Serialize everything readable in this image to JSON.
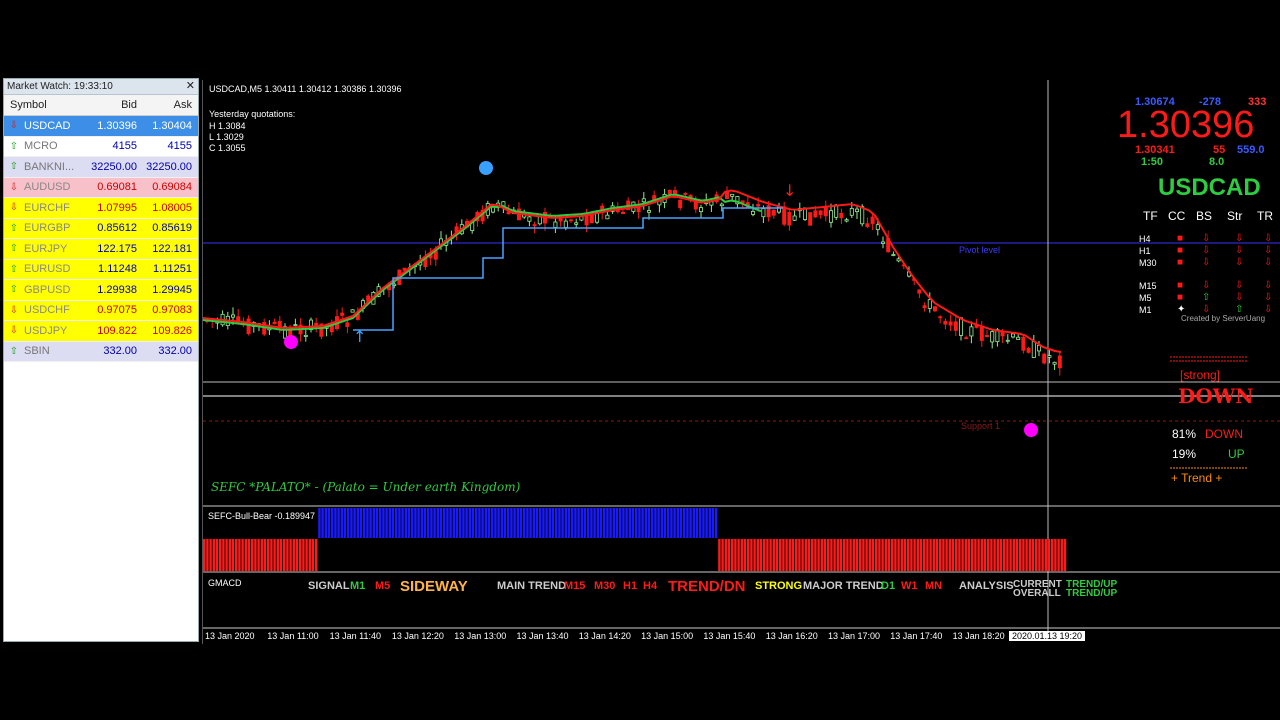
{
  "market_watch": {
    "title": "Market Watch: 19:33:10",
    "close": "✕",
    "columns": {
      "symbol": "Symbol",
      "bid": "Bid",
      "ask": "Ask"
    },
    "rows": [
      {
        "symbol": "USDCAD",
        "bid": "1.30396",
        "ask": "1.30404",
        "dir": "down",
        "bg": "#3d8ee6",
        "fg": "#ffffff"
      },
      {
        "symbol": "MCRO",
        "bid": "4155",
        "ask": "4155",
        "dir": "up",
        "bg": "#ffffff",
        "fg": "#777777"
      },
      {
        "symbol": "BANKNI...",
        "bid": "32250.00",
        "ask": "32250.00",
        "dir": "up",
        "bg": "#dcdcf2",
        "fg": "#777777"
      },
      {
        "symbol": "AUDUSD",
        "bid": "0.69081",
        "ask": "0.69084",
        "dir": "down",
        "bg": "#f8c0c8",
        "fg": "#888888"
      },
      {
        "symbol": "EURCHF",
        "bid": "1.07995",
        "ask": "1.08005",
        "dir": "down",
        "bg": "#ffff00",
        "fg": "#888888"
      },
      {
        "symbol": "EURGBP",
        "bid": "0.85612",
        "ask": "0.85619",
        "dir": "up",
        "bg": "#ffff00",
        "fg": "#888888"
      },
      {
        "symbol": "EURJPY",
        "bid": "122.175",
        "ask": "122.181",
        "dir": "up",
        "bg": "#ffff00",
        "fg": "#888888"
      },
      {
        "symbol": "EURUSD",
        "bid": "1.11248",
        "ask": "1.11251",
        "dir": "up",
        "bg": "#ffff00",
        "fg": "#888888"
      },
      {
        "symbol": "GBPUSD",
        "bid": "1.29938",
        "ask": "1.29945",
        "dir": "up",
        "bg": "#ffff00",
        "fg": "#888888"
      },
      {
        "symbol": "USDCHF",
        "bid": "0.97075",
        "ask": "0.97083",
        "dir": "down",
        "bg": "#ffff00",
        "fg": "#888888"
      },
      {
        "symbol": "USDJPY",
        "bid": "109.822",
        "ask": "109.826",
        "dir": "down",
        "bg": "#ffff00",
        "fg": "#888888"
      },
      {
        "symbol": "SBIN",
        "bid": "332.00",
        "ask": "332.00",
        "dir": "up",
        "bg": "#dcdcf2",
        "fg": "#777777"
      }
    ]
  },
  "chart": {
    "header": "USDCAD,M5  1.30411 1.30412 1.30386 1.30396",
    "yesterday": [
      "Yesterday quotations:",
      "H 1.3084",
      "L 1.3029",
      "C 1.3055"
    ],
    "pivot_label": "Pivot level",
    "support_label": "Support 1",
    "sefc_note": "SEFC *PALATO* - (Palato = Under earth Kingdom)",
    "colors": {
      "bull": "#90ee90",
      "bear": "#ff1a1a",
      "ma_green": "#2ecc40",
      "ma_red": "#ff1a1a",
      "ma_blue": "#4aa3ff",
      "pivot": "#3333ff"
    }
  },
  "right_panel": {
    "top_left": "1.30674",
    "top_mid": "-278",
    "top_right": "333",
    "big_price": "1.30396",
    "row2_left": "1.30341",
    "row2_mid": "55",
    "row2_right": "559.0",
    "ratio": "1:50",
    "ratio2": "8.0",
    "symbol": "USDCAD",
    "columns": [
      "TF",
      "CC",
      "BS",
      "Str",
      "TR"
    ],
    "timeframes": [
      "H4",
      "H1",
      "M30",
      "M15",
      "M5",
      "M1"
    ],
    "created_by": "Created by ServerUang",
    "strong": "[strong]",
    "down": "DOWN",
    "pct_down": "81%",
    "label_down": "DOWN",
    "pct_up": "19%",
    "label_up": "UP",
    "trend": "+  Trend  +"
  },
  "bull_bear": {
    "label": "SEFC-Bull-Bear -0.189947"
  },
  "gmacd": {
    "label": "GMACD",
    "signal": "SIGNAL",
    "m1": "M1",
    "m5": "M5",
    "sideway": "SIDEWAY",
    "main_trend": "MAIN TREND",
    "m15": "M15",
    "m30": "M30",
    "h1": "H1",
    "h4": "H4",
    "trend_dn": "TREND/DN",
    "strong": "STRONG",
    "major_trend": "MAJOR TREND",
    "d1": "D1",
    "w1": "W1",
    "mn": "MN",
    "analysis": "ANALYSIS",
    "current": "CURRENT",
    "overall": "OVERALL",
    "trend_up1": "TREND/UP",
    "trend_up2": "TREND/UP"
  },
  "time_axis": [
    "13 Jan 2020",
    "13 Jan 11:00",
    "13 Jan 11:40",
    "13 Jan 12:20",
    "13 Jan 13:00",
    "13 Jan 13:40",
    "13 Jan 14:20",
    "13 Jan 15:00",
    "13 Jan 15:40",
    "13 Jan 16:20",
    "13 Jan 17:00",
    "13 Jan 17:40",
    "13 Jan 18:20"
  ],
  "time_cursor": "2020.01.13 19:20"
}
